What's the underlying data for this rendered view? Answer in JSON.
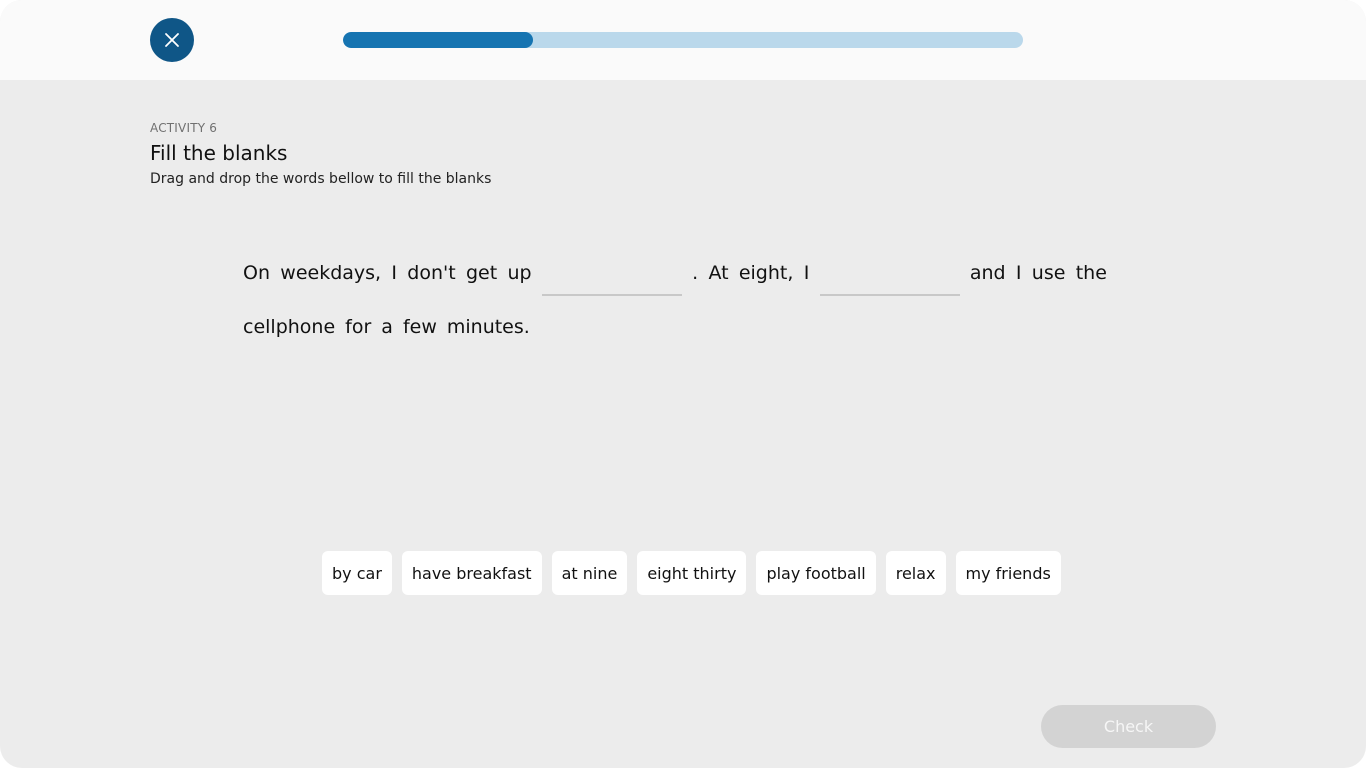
{
  "progress": {
    "fraction": 0.28,
    "color": "#1674b1",
    "track_color": "#bad8eb"
  },
  "header": {
    "close_icon": "close-icon"
  },
  "activity": {
    "label": "ACTIVITY 6",
    "title": "Fill the blanks",
    "instructions": "Drag and drop the words bellow to fill the blanks"
  },
  "sentence": {
    "line1": [
      "On",
      "weekdays,",
      "I",
      "don't",
      "get",
      "up",
      "__BLANK__",
      ".",
      "At",
      "eight,",
      "I",
      "__BLANK__",
      "and",
      "I",
      "use",
      "the"
    ],
    "line2": [
      "cellphone",
      "for",
      "a",
      "few",
      "minutes."
    ]
  },
  "word_bank": [
    "by car",
    "have breakfast",
    "at nine",
    "eight thirty",
    "play football",
    "relax",
    "my friends"
  ],
  "check_button": {
    "label": "Check",
    "state": "disabled"
  },
  "colors": {
    "accent": "#0f5687",
    "background": "#ececec"
  }
}
